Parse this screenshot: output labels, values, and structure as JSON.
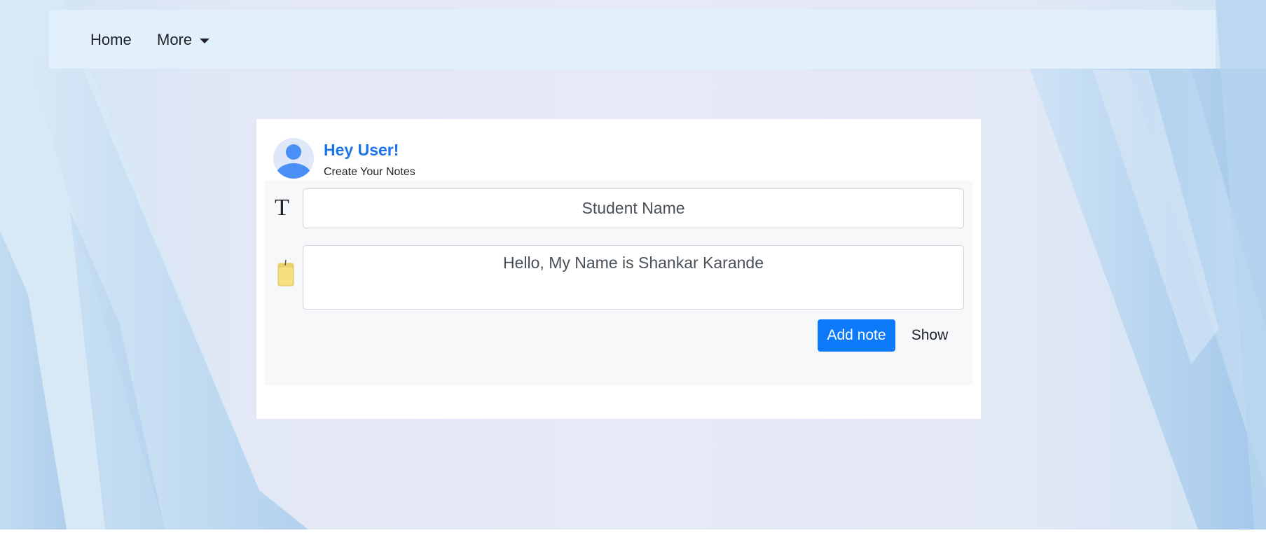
{
  "navbar": {
    "home_label": "Home",
    "more_label": "More"
  },
  "card": {
    "greeting": "Hey User!",
    "subtitle": "Create Your Notes",
    "title_field": {
      "value": "Student Name"
    },
    "note_field": {
      "value": "Hello, My Name is Shankar Karande"
    },
    "add_button_label": "Add note",
    "show_button_label": "Show"
  },
  "colors": {
    "accent": "#0d7bf9",
    "greeting": "#1a73e8",
    "navbar_bg": "#e2f0fc"
  },
  "icons": {
    "avatar": "user-avatar-icon",
    "title": "text-t-icon",
    "note": "sticky-note-icon",
    "dropdown": "caret-down-icon"
  }
}
